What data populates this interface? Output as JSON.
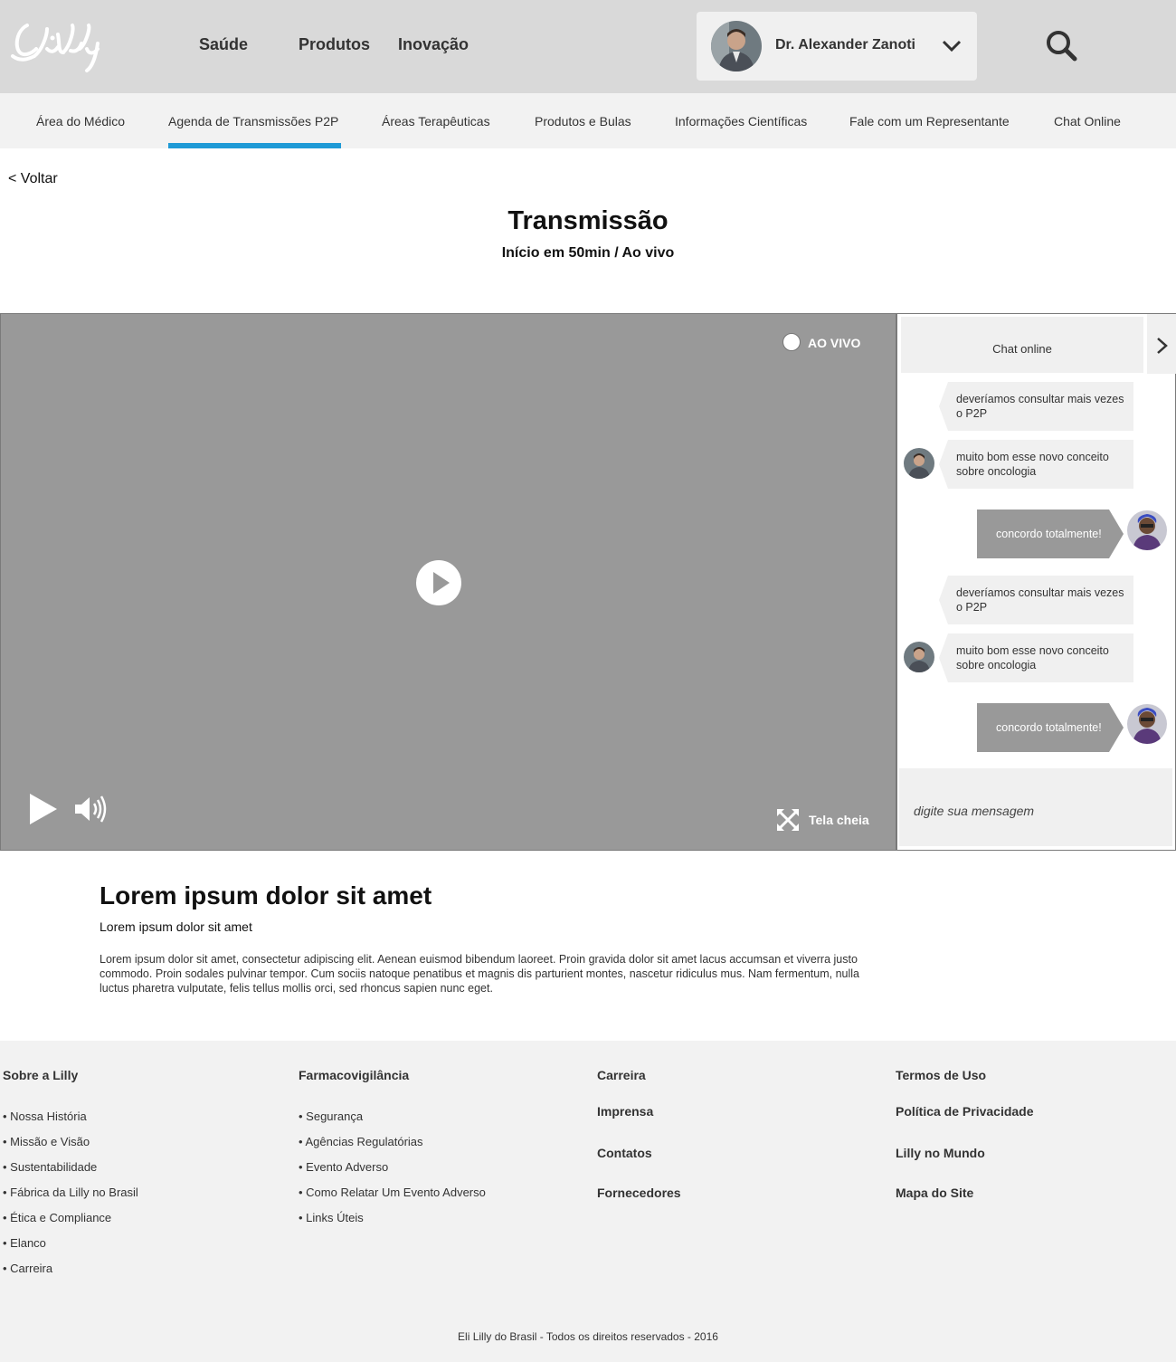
{
  "header": {
    "logo_text": "Lilly",
    "nav": [
      "Saúde",
      "Produtos",
      "Inovação"
    ],
    "user": {
      "name": "Dr. Alexander Zanoti"
    }
  },
  "subnav": {
    "items": [
      "Área do Médico",
      "Agenda de Transmissões P2P",
      "Áreas Terapêuticas",
      "Produtos e Bulas",
      "Informações Científicas",
      "Fale com um Representante",
      "Chat Online"
    ],
    "active_index": 1
  },
  "page": {
    "back": "< Voltar",
    "title": "Transmissão",
    "subtitle": "Início em 50min / Ao vivo"
  },
  "player": {
    "live_label": "AO VIVO",
    "fullscreen_label": "Tela cheia"
  },
  "chat": {
    "title": "Chat online",
    "messages": [
      {
        "text": "deveríamos consultar mais vezes o P2P",
        "direction": "in",
        "avatar": false
      },
      {
        "text": "muito bom esse novo conceito sobre oncologia",
        "direction": "in",
        "avatar": true
      },
      {
        "text": "concordo totalmente!",
        "direction": "out",
        "avatar": true
      },
      {
        "text": "deveríamos consultar mais vezes o P2P",
        "direction": "in",
        "avatar": false
      },
      {
        "text": "muito bom esse novo conceito sobre oncologia",
        "direction": "in",
        "avatar": true
      },
      {
        "text": "concordo totalmente!",
        "direction": "out",
        "avatar": true
      }
    ],
    "input_placeholder": "digite sua mensagem"
  },
  "content": {
    "title": "Lorem ipsum dolor sit amet",
    "subtitle": "Lorem ipsum dolor sit amet",
    "body": "Lorem ipsum dolor sit amet, consectetur adipiscing elit. Aenean euismod bibendum laoreet. Proin gravida dolor sit amet lacus accumsan et viverra justo commodo. Proin sodales pulvinar tempor. Cum sociis natoque penatibus et magnis dis parturient montes, nascetur ridiculus mus. Nam fermentum, nulla luctus pharetra vulputate, felis tellus mollis orci, sed rhoncus sapien nunc eget."
  },
  "footer": {
    "col1": {
      "heading": "Sobre a Lilly",
      "links": [
        "• Nossa História",
        "• Missão e Visão",
        "• Sustentabilidade",
        "• Fábrica da Lilly no Brasil",
        "• Ética e Compliance",
        "• Elanco",
        "• Carreira"
      ]
    },
    "col2": {
      "heading": "Farmacovigilância",
      "links": [
        "• Segurança",
        "• Agências Regulatórias",
        "• Evento Adverso",
        "• Como Relatar Um Evento Adverso",
        "• Links Úteis"
      ]
    },
    "col3": [
      "Carreira",
      "Imprensa",
      "Contatos",
      "Fornecedores"
    ],
    "col4": [
      "Termos de Uso",
      "Política de Privacidade",
      "Lilly no Mundo",
      "Mapa do Site"
    ],
    "copyright": "Eli Lilly do Brasil - Todos os direitos reservados - 2016"
  },
  "colors": {
    "header_bg": "#d9d9d9",
    "subnav_bg": "#f2f2f2",
    "accent": "#1e9ad6",
    "player_bg": "#999999",
    "bubble_in": "#f0f0f0",
    "bubble_out": "#999999"
  }
}
